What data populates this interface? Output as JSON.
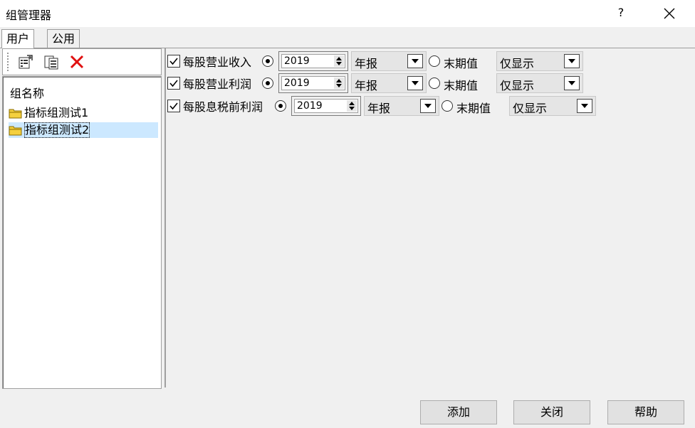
{
  "window": {
    "title": "组管理器",
    "help": "?"
  },
  "tabs": [
    {
      "label": "用户"
    },
    {
      "label": "公用"
    }
  ],
  "left": {
    "header": "组名称",
    "items": [
      {
        "label": "指标组测试1"
      },
      {
        "label": "指标组测试2"
      }
    ]
  },
  "rows": [
    {
      "label": "每股营业收入",
      "year": "2019",
      "period": "年报",
      "option_label": "末期值",
      "display": "仅显示"
    },
    {
      "label": "每股营业利润",
      "year": "2019",
      "period": "年报",
      "option_label": "末期值",
      "display": "仅显示"
    },
    {
      "label": "每股息税前利润",
      "year": "2019",
      "period": "年报",
      "option_label": "末期值",
      "display": "仅显示"
    }
  ],
  "buttons": {
    "add": "添加",
    "close": "关闭",
    "help": "帮助"
  }
}
